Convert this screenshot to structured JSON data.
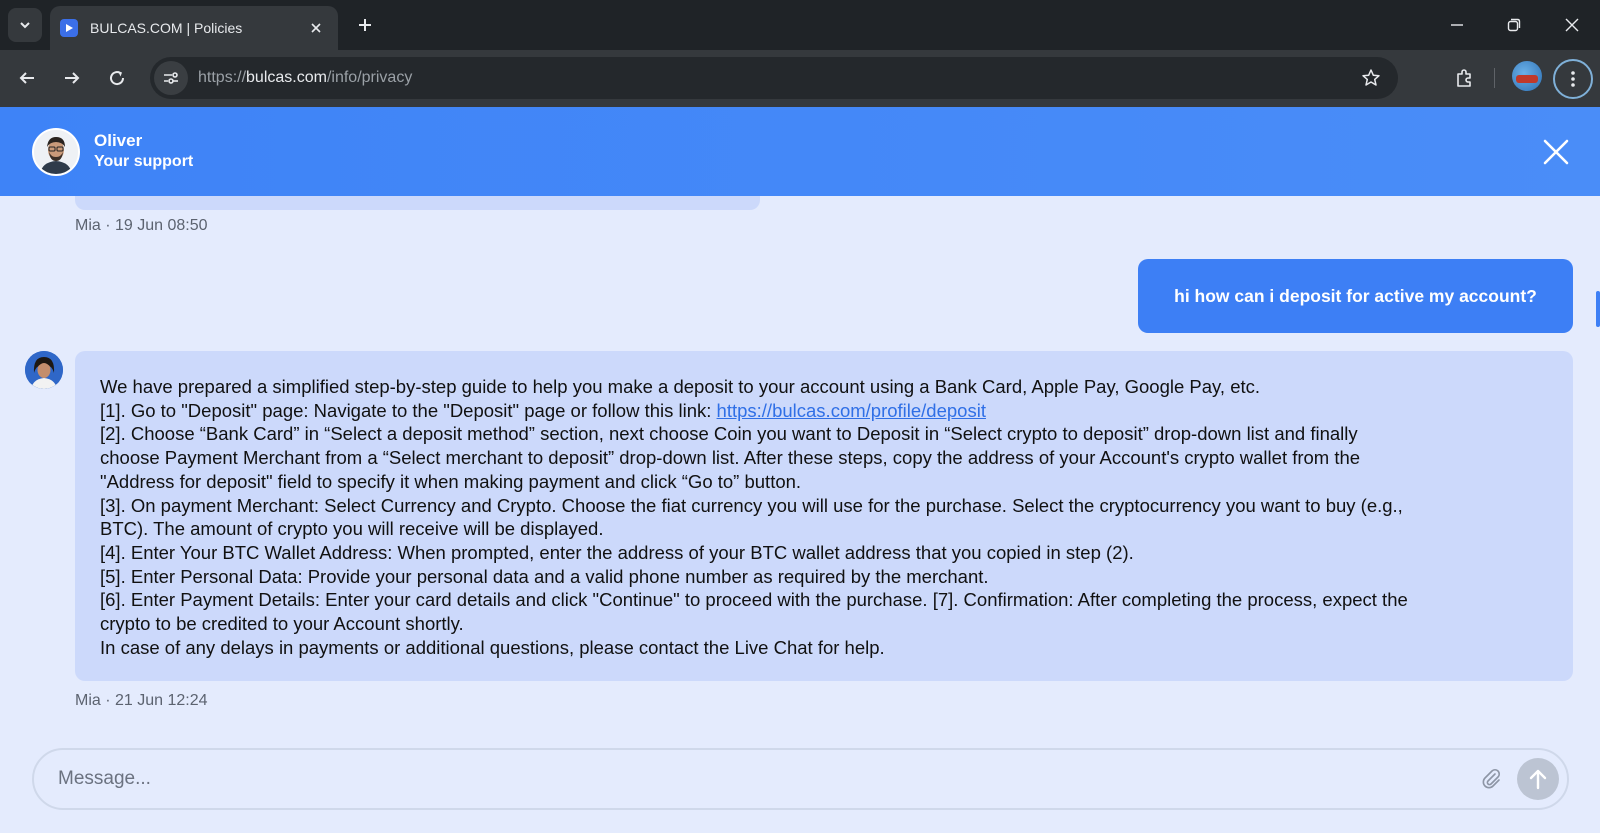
{
  "browser": {
    "tab_title": "BULCAS.COM | Policies",
    "url_scheme": "https://",
    "url_host": "bulcas.com",
    "url_path": "/info/privacy"
  },
  "chat_header": {
    "agent_name": "Oliver",
    "agent_role": "Your support"
  },
  "messages": {
    "prev_meta": "Mia · 19 Jun 08:50",
    "user_message": "hi how can i deposit for active my account?",
    "bot_lines": [
      "We have prepared a simplified step-by-step guide to help you make a deposit to your account using a Bank Card, Apple Pay, Google Pay, etc.",
      "[1]. Go to \"Deposit\" page: Navigate to the \"Deposit\" page or follow this link: ",
      "[2]. Choose “Bank Card” in “Select a deposit method” section, next choose Coin you want to Deposit in “Select crypto to deposit” drop-down list and finally",
      "choose Payment Merchant from a “Select merchant to deposit” drop-down list. After these steps, copy the address of your Account's crypto wallet from the",
      "\"Address for deposit\" field to specify it when making payment and click “Go to” button.",
      "[3]. On payment Merchant: Select Currency and Crypto. Choose the fiat currency you will use for the purchase. Select the cryptocurrency you want to buy (e.g.,",
      "BTC). The amount of crypto you will receive will be displayed.",
      "[4]. Enter Your BTC Wallet Address: When prompted, enter the address of your BTC wallet address that you copied in step (2).",
      "[5]. Enter Personal Data: Provide your personal data and a valid phone number as required by the merchant.",
      "[6]. Enter Payment Details: Enter your card details and click \"Continue\" to proceed with the purchase. [7]. Confirmation: After completing the process, expect the",
      "crypto to be credited to your Account shortly.",
      "In case of any delays in payments or additional questions, please contact the Live Chat for help."
    ],
    "deposit_link": "https://bulcas.com/profile/deposit",
    "bot_meta": "Mia · 21 Jun 12:24"
  },
  "composer": {
    "placeholder": "Message..."
  },
  "colors": {
    "header_blue": "#3e83f7",
    "user_bubble": "#3d7ff5",
    "bot_bubble": "#ccd9fb",
    "chat_bg": "#e4ebfd",
    "link": "#2f6fe6"
  },
  "icons": [
    "tab-list-icon",
    "favicon-icon",
    "close-tab-icon",
    "plus-icon",
    "minimize-icon",
    "restore-icon",
    "close-window-icon",
    "back-icon",
    "forward-icon",
    "reload-icon",
    "site-info-icon",
    "star-icon",
    "extensions-icon",
    "menu-icon",
    "close-chat-icon",
    "attach-icon",
    "send-arrow-icon"
  ]
}
